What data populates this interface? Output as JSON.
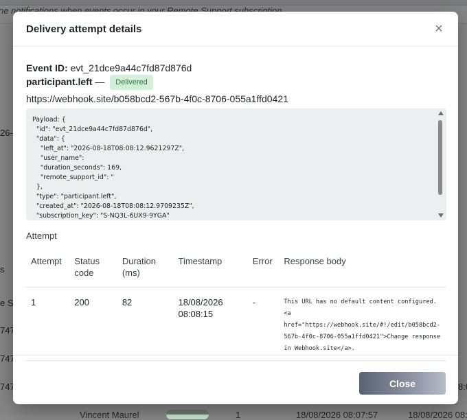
{
  "background": {
    "subtitle": "ne notifications when events occur in your Remote Support subscription",
    "left_fragment_1": "26-",
    "left_fragment_2": "s",
    "left_fragment_3": "e Su",
    "row_fragments": [
      "747",
      "747",
      "747"
    ],
    "bottom_name": "Vincent Maurel",
    "bottom_count": "1",
    "bottom_date_1": "18/08/2026 08:07:57",
    "bottom_date_2": "18/08/2026 08:0",
    "right_fragment": "8:0"
  },
  "modal": {
    "title": "Delivery attempt details",
    "close_icon": "×",
    "event_id_label": "Event ID:",
    "event_id": "evt_21dce9a44c7fd87d876d",
    "event_type": "participant.left",
    "dash": "—",
    "status_badge": "Delivered",
    "url": "https://webhook.site/b058bcd2-567b-4f0c-8706-055a1ffd0421",
    "payload": "Payload: {\n  \"id\": \"evt_21dce9a44c7fd87d876d\",\n  \"data\": {\n    \"left_at\": \"2026-08-18T08:08:12.9621297Z\",\n    \"user_name\":\n    \"duration_seconds\": 169,\n    \"remote_support_id\": \"\n  },\n  \"type\": \"participant.left\",\n  \"created_at\": \"2026-08-18T08:08:12.9709235Z\",\n  \"subscription_key\": \"S-NQ3L-6UX9-9YGA\"",
    "section_label": "Attempt",
    "table": {
      "headers": [
        "Attempt",
        "Status code",
        "Duration (ms)",
        "Timestamp",
        "Error",
        "Response body"
      ],
      "rows": [
        {
          "attempt": "1",
          "status": "200",
          "duration": "82",
          "timestamp": "18/08/2026 08:08:15",
          "error": "-",
          "response": "This URL has no default content configured. <a href=\"https://webhook.site/#!/edit/b058bcd2-567b-4f0c-8706-055a1ffd0421\">Change response in Webhook.site</a>."
        }
      ]
    },
    "close_button": "Close"
  },
  "colors": {
    "badge_bg": "#d4efd9",
    "badge_text": "#1e7b34",
    "payload_bg": "#eceef0",
    "close_button": "#6b7384"
  }
}
